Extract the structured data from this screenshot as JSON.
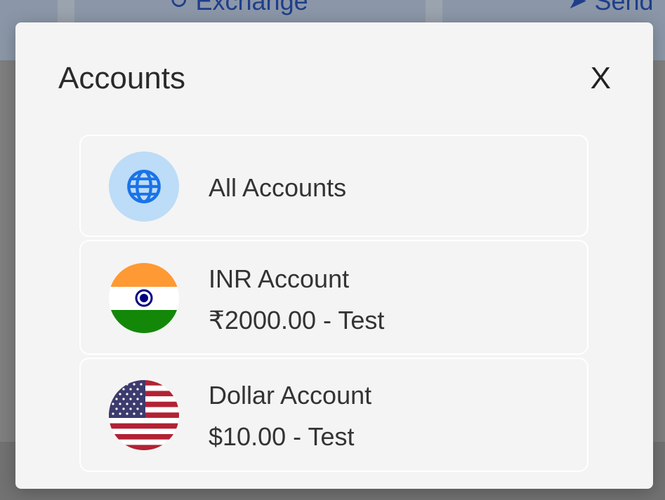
{
  "background": {
    "tabs": [
      {
        "label": "Exchange",
        "icon": "exchange-icon"
      },
      {
        "label": "Send",
        "icon": "send-icon"
      }
    ]
  },
  "modal": {
    "title": "Accounts",
    "close_label": "X",
    "accounts": [
      {
        "name": "All Accounts",
        "icon": "globe-icon",
        "icon_bg": "#bcdcf7",
        "icon_color": "#1a73e8"
      },
      {
        "name": "INR Account",
        "detail": "₹2000.00 - Test",
        "icon": "india-flag-icon"
      },
      {
        "name": "Dollar Account",
        "detail": "$10.00 - Test",
        "icon": "us-flag-icon"
      }
    ]
  },
  "colors": {
    "modal_bg": "#f4f4f4",
    "text": "#333333",
    "accent": "#1f3e8a"
  }
}
